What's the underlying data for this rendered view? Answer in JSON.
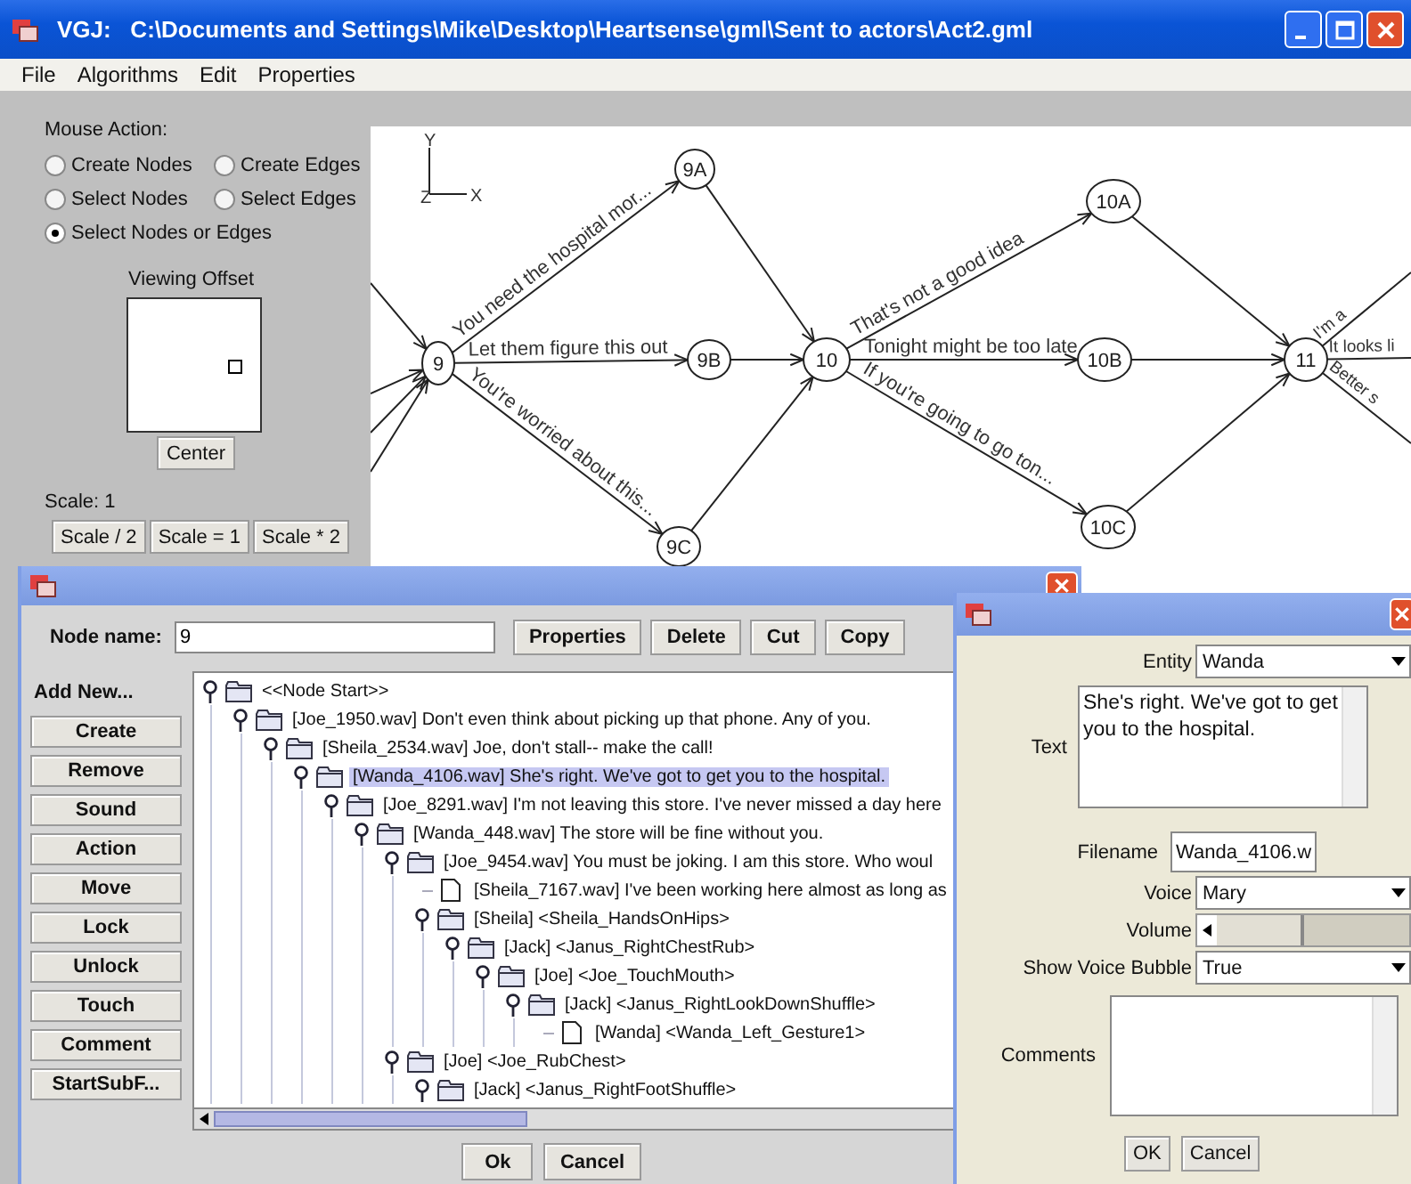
{
  "window": {
    "title": "VGJ:   C:\\Documents and Settings\\Mike\\Desktop\\Heartsense\\gml\\Sent to actors\\Act2.gml"
  },
  "menu": [
    "File",
    "Algorithms",
    "Edit",
    "Properties"
  ],
  "mouse_action": {
    "label": "Mouse Action:",
    "options": [
      {
        "label": "Create Nodes",
        "selected": false
      },
      {
        "label": "Create Edges",
        "selected": false
      },
      {
        "label": "Select Nodes",
        "selected": false
      },
      {
        "label": "Select Edges",
        "selected": false
      },
      {
        "label": "Select Nodes or Edges",
        "selected": true
      }
    ]
  },
  "viewing_offset": {
    "label": "Viewing Offset",
    "button": "Center"
  },
  "scale": {
    "label": "Scale: 1",
    "buttons": [
      "Scale / 2",
      "Scale = 1",
      "Scale * 2"
    ]
  },
  "graph": {
    "axes": [
      "Y",
      "Z",
      "X"
    ],
    "nodes": [
      {
        "label": "9"
      },
      {
        "label": "9A"
      },
      {
        "label": "9B"
      },
      {
        "label": "9C"
      },
      {
        "label": "10"
      },
      {
        "label": "10A"
      },
      {
        "label": "10B"
      },
      {
        "label": "10C"
      },
      {
        "label": "11"
      }
    ],
    "edges": [
      {
        "label": "You need the hospital mor..."
      },
      {
        "label": "Let them figure this out"
      },
      {
        "label": "You're worried about this..."
      },
      {
        "label": "That's not a good idea"
      },
      {
        "label": "Tonight might be too late"
      },
      {
        "label": "If you're going to go ton..."
      },
      {
        "label": "I'm a"
      },
      {
        "label": "It looks li"
      },
      {
        "label": "Better s"
      }
    ]
  },
  "node_dialog": {
    "name_label": "Node name:",
    "name_value": "9",
    "buttons": [
      "Properties",
      "Delete",
      "Cut",
      "Copy"
    ],
    "add_label": "Add New...",
    "add_buttons": [
      "Create",
      "Remove",
      "Sound",
      "Action",
      "Move",
      "Lock",
      "Unlock",
      "Touch",
      "Comment",
      "StartSubF..."
    ],
    "tree": [
      {
        "kind": "folder",
        "expanded": true,
        "selected": false,
        "text": "<<Node Start>>",
        "children": [
          {
            "kind": "folder",
            "expanded": true,
            "selected": false,
            "text": "[Joe_1950.wav]  Don't even think about picking up that phone. Any of you.",
            "children": [
              {
                "kind": "folder",
                "expanded": true,
                "selected": false,
                "text": "[Sheila_2534.wav]  Joe, don't stall-- make the call!",
                "children": [
                  {
                    "kind": "folder",
                    "expanded": true,
                    "selected": true,
                    "text": "[Wanda_4106.wav]  She's right. We've got to get you to the hospital.",
                    "children": [
                      {
                        "kind": "folder",
                        "expanded": true,
                        "selected": false,
                        "text": "[Joe_8291.wav]  I'm not leaving this store. I've never missed a day here",
                        "children": [
                          {
                            "kind": "folder",
                            "expanded": true,
                            "selected": false,
                            "text": "[Wanda_448.wav]  The store will be fine without you.",
                            "children": [
                              {
                                "kind": "folder",
                                "expanded": true,
                                "selected": false,
                                "text": "[Joe_9454.wav]  You must be joking. I am this store.  Who woul",
                                "children": [
                                  {
                                    "kind": "file",
                                    "selected": false,
                                    "text": "[Sheila_7167.wav]  I've been working here almost as long as"
                                  },
                                  {
                                    "kind": "folder",
                                    "expanded": true,
                                    "selected": false,
                                    "text": "[Sheila] <Sheila_HandsOnHips>",
                                    "children": [
                                      {
                                        "kind": "folder",
                                        "expanded": true,
                                        "selected": false,
                                        "text": "[Jack] <Janus_RightChestRub>",
                                        "children": [
                                          {
                                            "kind": "folder",
                                            "expanded": true,
                                            "selected": false,
                                            "text": "[Joe] <Joe_TouchMouth>",
                                            "children": [
                                              {
                                                "kind": "folder",
                                                "expanded": true,
                                                "selected": false,
                                                "text": "[Jack] <Janus_RightLookDownShuffle>",
                                                "children": [
                                                  {
                                                    "kind": "file",
                                                    "selected": false,
                                                    "text": "[Wanda] <Wanda_Left_Gesture1>"
                                                  }
                                                ]
                                              }
                                            ]
                                          }
                                        ]
                                      }
                                    ]
                                  }
                                ]
                              },
                              {
                                "kind": "folder",
                                "expanded": true,
                                "selected": false,
                                "text": "[Joe] <Joe_RubChest>",
                                "children": [
                                  {
                                    "kind": "folder",
                                    "expanded": true,
                                    "selected": false,
                                    "text": "[Jack] <Janus_RightFootShuffle>"
                                  }
                                ]
                              }
                            ]
                          }
                        ]
                      }
                    ]
                  }
                ]
              }
            ]
          }
        ]
      }
    ],
    "footer_buttons": [
      "Ok",
      "Cancel"
    ]
  },
  "properties_dialog": {
    "entity": {
      "label": "Entity",
      "value": "Wanda"
    },
    "text": {
      "label": "Text",
      "value": "She's right. We've got to get you to the hospital."
    },
    "filename": {
      "label": "Filename",
      "value": "Wanda_4106.w"
    },
    "voice": {
      "label": "Voice",
      "value": "Mary"
    },
    "volume": {
      "label": "Volume",
      "level": 0.45
    },
    "show_voice_bubble": {
      "label": "Show Voice Bubble",
      "value": "True"
    },
    "comments": {
      "label": "Comments"
    },
    "buttons": [
      "OK",
      "Cancel"
    ]
  }
}
